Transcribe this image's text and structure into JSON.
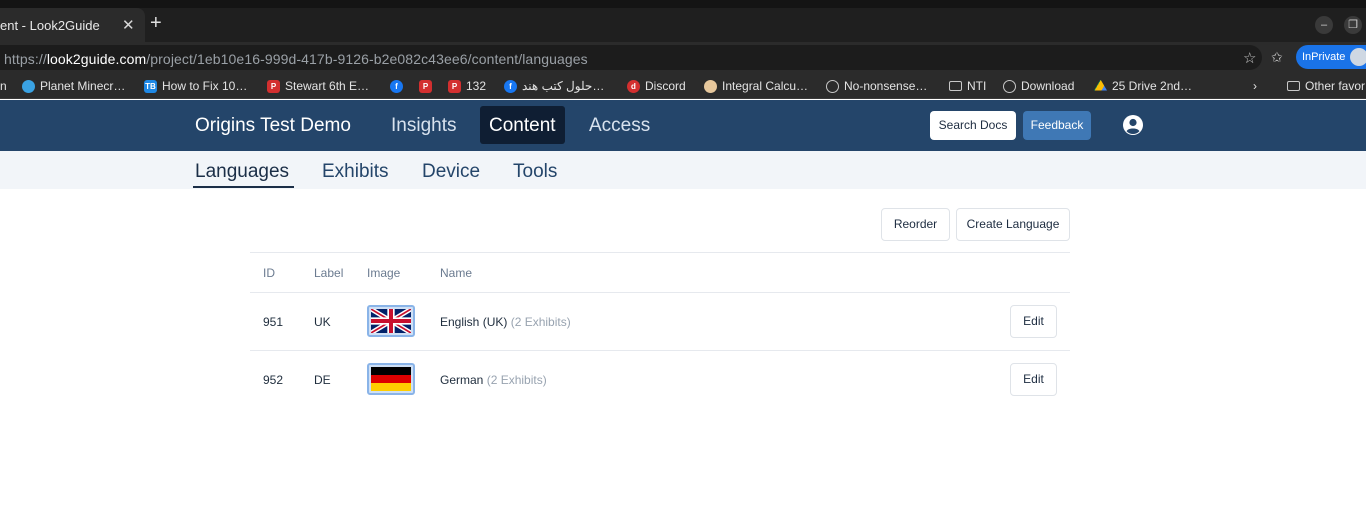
{
  "browser": {
    "tab_title": "ent - Look2Guide",
    "tab_close": "✕",
    "new_tab": "+",
    "url_scheme": "https://",
    "url_host": "look2guide.com",
    "url_path": "/project/1eb10e16-999d-417b-9126-b2e082c43ee6/content/languages",
    "inprivate_label": "InPrivate",
    "bookmarks": [
      {
        "label": "Planet Minecr…",
        "icon": "globe-icon",
        "color": "#3aa2e3"
      },
      {
        "label": "How to Fix 10…",
        "icon": "tb-icon",
        "color": "#1e88e5"
      },
      {
        "label": "Stewart 6th E…",
        "icon": "pdf-icon",
        "color": "#d32f2f"
      },
      {
        "label": "",
        "icon": "facebook-icon",
        "color": "#1877f2"
      },
      {
        "label": "",
        "icon": "pdf-icon",
        "color": "#d32f2f"
      },
      {
        "label": "132",
        "icon": "pdf-icon",
        "color": "#d32f2f"
      },
      {
        "label": "حلول كتب هند…",
        "icon": "facebook-icon",
        "color": "#1877f2"
      },
      {
        "label": "Discord",
        "icon": "discord-icon",
        "color": "#d32f2f"
      },
      {
        "label": "Integral Calcu…",
        "icon": "calc-icon",
        "color": "#e6c79c"
      },
      {
        "label": "No-nonsense…",
        "icon": "globe-icon",
        "color": "#9aa0a6"
      },
      {
        "label": "NTI",
        "icon": "folder-icon",
        "color": "#9aa0a6"
      },
      {
        "label": "Download",
        "icon": "globe-icon",
        "color": "#9aa0a6"
      },
      {
        "label": "25 Drive 2nd…",
        "icon": "drive-icon",
        "color": "#fbbc04"
      }
    ],
    "other_favorites": "Other favor"
  },
  "header": {
    "brand": "Origins Test Demo",
    "nav": [
      {
        "label": "Insights",
        "active": false
      },
      {
        "label": "Content",
        "active": true
      },
      {
        "label": "Access",
        "active": false
      }
    ],
    "search_docs": "Search Docs",
    "feedback": "Feedback"
  },
  "subnav": {
    "tabs": [
      {
        "label": "Languages",
        "active": true
      },
      {
        "label": "Exhibits",
        "active": false
      },
      {
        "label": "Device",
        "active": false
      },
      {
        "label": "Tools",
        "active": false
      }
    ]
  },
  "toolbar": {
    "reorder": "Reorder",
    "create_language": "Create Language"
  },
  "table": {
    "columns": [
      "ID",
      "Label",
      "Image",
      "Name"
    ],
    "rows": [
      {
        "id": "951",
        "label": "UK",
        "flag": "uk-flag-icon",
        "name": "English (UK)",
        "exhibits": "(2 Exhibits)",
        "action": "Edit"
      },
      {
        "id": "952",
        "label": "DE",
        "flag": "germany-flag-icon",
        "name": "German",
        "exhibits": "(2 Exhibits)",
        "action": "Edit"
      }
    ]
  },
  "colors": {
    "header_bg": "#24456a",
    "active_nav_bg": "#0f1e33",
    "feedback_bg": "#3f78b5",
    "subnav_bg": "#f2f5f9"
  }
}
